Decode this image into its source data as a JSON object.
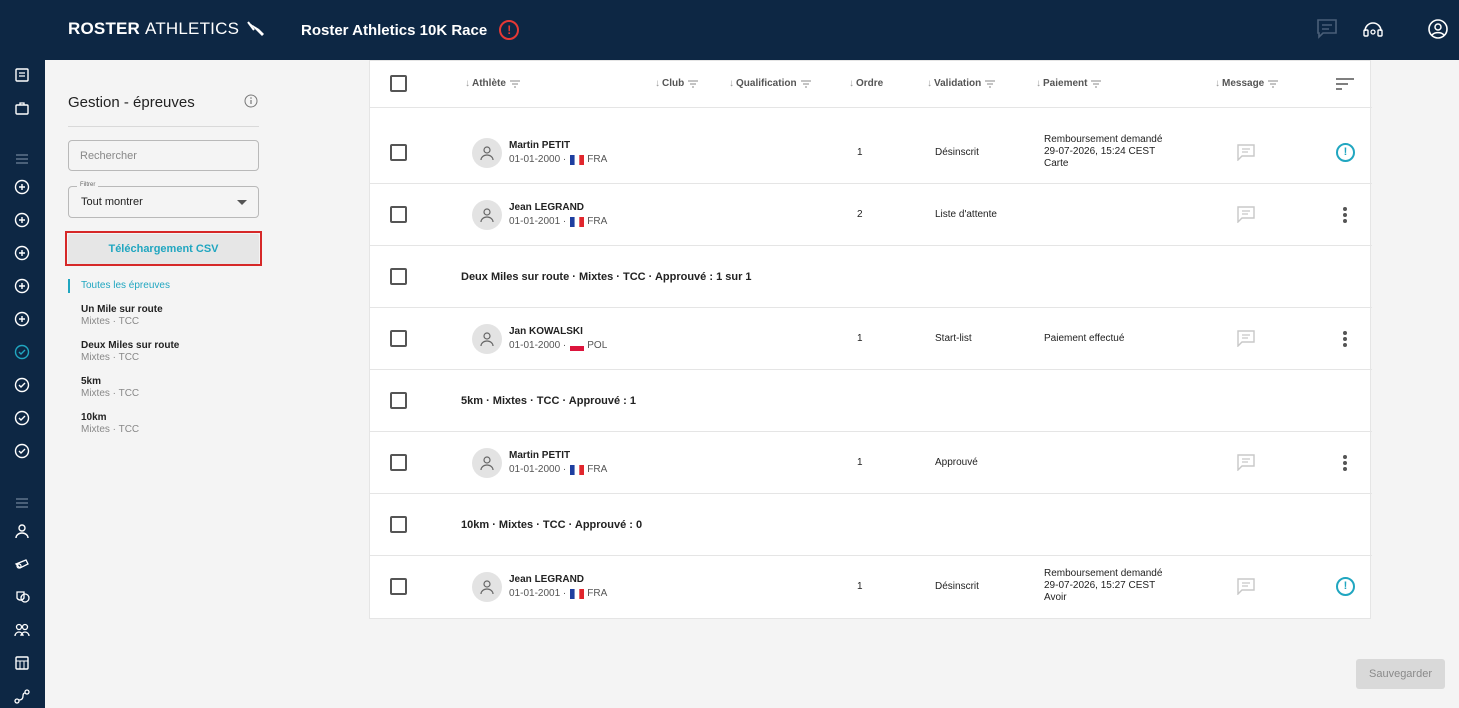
{
  "header": {
    "brand_bold": "ROSTER",
    "brand_light": "ATHLETICS",
    "event_title": "Roster Athletics 10K Race",
    "alert_icon": "alert-circle-icon",
    "icons": [
      "chat-icon",
      "support-icon",
      "account-icon"
    ]
  },
  "sidebar": {
    "title": "Gestion - épreuves",
    "search_placeholder": "Rechercher",
    "filter_legend": "Filtrer",
    "filter_value": "Tout montrer",
    "csv_label": "Téléchargement CSV",
    "all_events_label": "Toutes les épreuves",
    "events": [
      {
        "name": "Un Mile sur route",
        "sub": "Mixtes · TCC"
      },
      {
        "name": "Deux Miles sur route",
        "sub": "Mixtes · TCC"
      },
      {
        "name": "5km",
        "sub": "Mixtes · TCC"
      },
      {
        "name": "10km",
        "sub": "Mixtes · TCC"
      }
    ]
  },
  "table": {
    "columns": {
      "athlete": "Athlète",
      "club": "Club",
      "qualification": "Qualification",
      "ordre": "Ordre",
      "validation": "Validation",
      "paiement": "Paiement",
      "message": "Message"
    },
    "rows": [
      {
        "name": "Martin PETIT",
        "dob": "01-01-2000 ·",
        "country": "FRA",
        "order": "1",
        "validation": "Désinscrit",
        "pay1": "Remboursement demandé",
        "pay2": "29-07-2026, 15:24 CEST",
        "pay3": "Carte"
      },
      {
        "name": "Jean LEGRAND",
        "dob": "01-01-2001 ·",
        "country": "FRA",
        "order": "2",
        "validation": "Liste d'attente"
      },
      {
        "group": "Deux Miles sur route · Mixtes · TCC · Approuvé : 1 sur 1"
      },
      {
        "name": "Jan KOWALSKI",
        "dob": "01-01-2000 ·",
        "country": "POL",
        "order": "1",
        "validation": "Start-list",
        "pay1": "Paiement effectué"
      },
      {
        "group": "5km · Mixtes · TCC · Approuvé : 1"
      },
      {
        "name": "Martin PETIT",
        "dob": "01-01-2000 ·",
        "country": "FRA",
        "order": "1",
        "validation": "Approuvé"
      },
      {
        "group": "10km · Mixtes · TCC · Approuvé : 0"
      },
      {
        "name": "Jean LEGRAND",
        "dob": "01-01-2001 ·",
        "country": "FRA",
        "order": "1",
        "validation": "Désinscrit",
        "pay1": "Remboursement demandé",
        "pay2": "29-07-2026, 15:27 CEST",
        "pay3": "Avoir"
      }
    ]
  },
  "footer": {
    "save_label": "Sauvegarder"
  },
  "colors": {
    "navy": "#0d2744",
    "accent": "#20a6c0",
    "alert": "#e53935",
    "highlight": "#d62828"
  }
}
